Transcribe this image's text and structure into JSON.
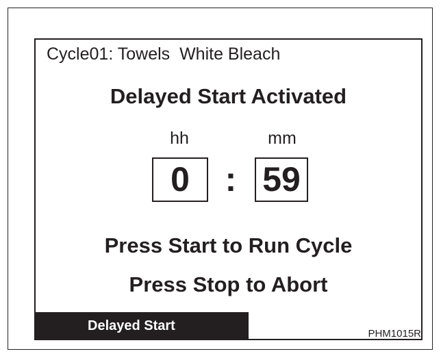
{
  "screen": {
    "cycle_title": "Cycle01: Towels  White Bleach",
    "status_heading": "Delayed Start Activated",
    "timer": {
      "hours_label": "hh",
      "minutes_label": "mm",
      "hours": "0",
      "separator": ":",
      "minutes": "59"
    },
    "instructions": {
      "start": "Press Start to Run Cycle",
      "stop": "Press Stop to Abort"
    },
    "status_tab": "Delayed Start"
  },
  "figure_code": "PHM1015R",
  "colors": {
    "ink": "#231f20",
    "background": "#ffffff",
    "tab_text": "#ffffff"
  }
}
